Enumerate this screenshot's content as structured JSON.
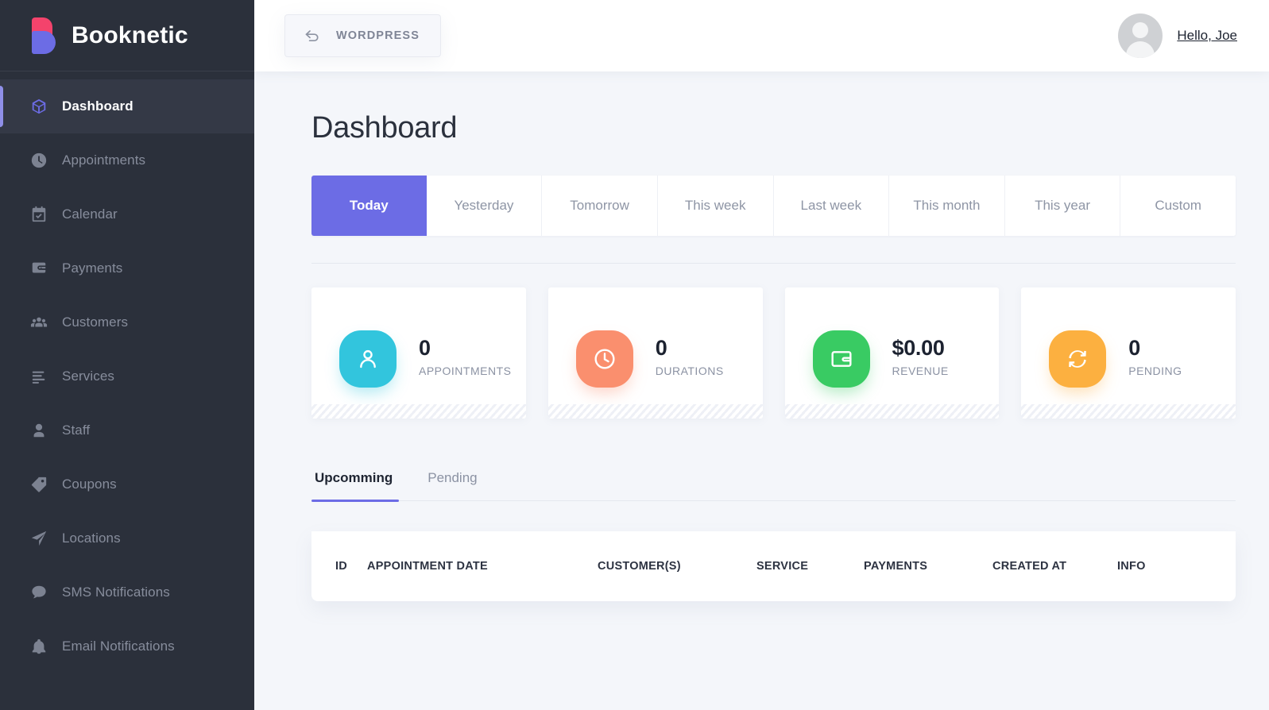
{
  "sidebar": {
    "brand": "Booknetic",
    "items": [
      {
        "label": "Dashboard",
        "icon": "cube-icon",
        "active": true
      },
      {
        "label": "Appointments",
        "icon": "clock-icon",
        "active": false
      },
      {
        "label": "Calendar",
        "icon": "calendar-check-icon",
        "active": false
      },
      {
        "label": "Payments",
        "icon": "wallet-icon",
        "active": false
      },
      {
        "label": "Customers",
        "icon": "users-icon",
        "active": false
      },
      {
        "label": "Services",
        "icon": "list-icon",
        "active": false
      },
      {
        "label": "Staff",
        "icon": "user-icon",
        "active": false
      },
      {
        "label": "Coupons",
        "icon": "tag-icon",
        "active": false
      },
      {
        "label": "Locations",
        "icon": "paper-plane-icon",
        "active": false
      },
      {
        "label": "SMS Notifications",
        "icon": "chat-bubble-icon",
        "active": false
      },
      {
        "label": "Email Notifications",
        "icon": "bell-icon",
        "active": false
      }
    ]
  },
  "topbar": {
    "back_button_label": "WORDPRESS",
    "back_button_icon": "back-arrow-icon",
    "user_greeting": "Hello, Joe",
    "avatar_icon": "user-avatar-icon"
  },
  "page": {
    "title": "Dashboard"
  },
  "date_filters": {
    "tabs": [
      {
        "label": "Today",
        "active": true
      },
      {
        "label": "Yesterday",
        "active": false
      },
      {
        "label": "Tomorrow",
        "active": false
      },
      {
        "label": "This week",
        "active": false
      },
      {
        "label": "Last week",
        "active": false
      },
      {
        "label": "This month",
        "active": false
      },
      {
        "label": "This year",
        "active": false
      },
      {
        "label": "Custom",
        "active": false
      }
    ]
  },
  "stats": [
    {
      "value": "0",
      "label": "APPOINTMENTS",
      "icon": "person-icon",
      "color": "#32c5dd"
    },
    {
      "value": "0",
      "label": "DURATIONS",
      "icon": "clock-icon",
      "color": "#fa8f6e"
    },
    {
      "value": "$0.00",
      "label": "REVENUE",
      "icon": "wallet-icon",
      "color": "#39cb63"
    },
    {
      "value": "0",
      "label": "PENDING",
      "icon": "refresh-icon",
      "color": "#fcb040"
    }
  ],
  "list_tabs": [
    {
      "label": "Upcomming",
      "active": true
    },
    {
      "label": "Pending",
      "active": false
    }
  ],
  "table": {
    "columns": [
      "ID",
      "APPOINTMENT DATE",
      "CUSTOMER(S)",
      "SERVICE",
      "PAYMENTS",
      "CREATED AT",
      "INFO"
    ],
    "rows": []
  },
  "colors": {
    "accent": "#6c6ce5",
    "sidebar_bg": "#2b303b",
    "sidebar_active_bg": "#343946",
    "page_bg": "#f4f6fa",
    "brand_pink": "#f4436c"
  }
}
